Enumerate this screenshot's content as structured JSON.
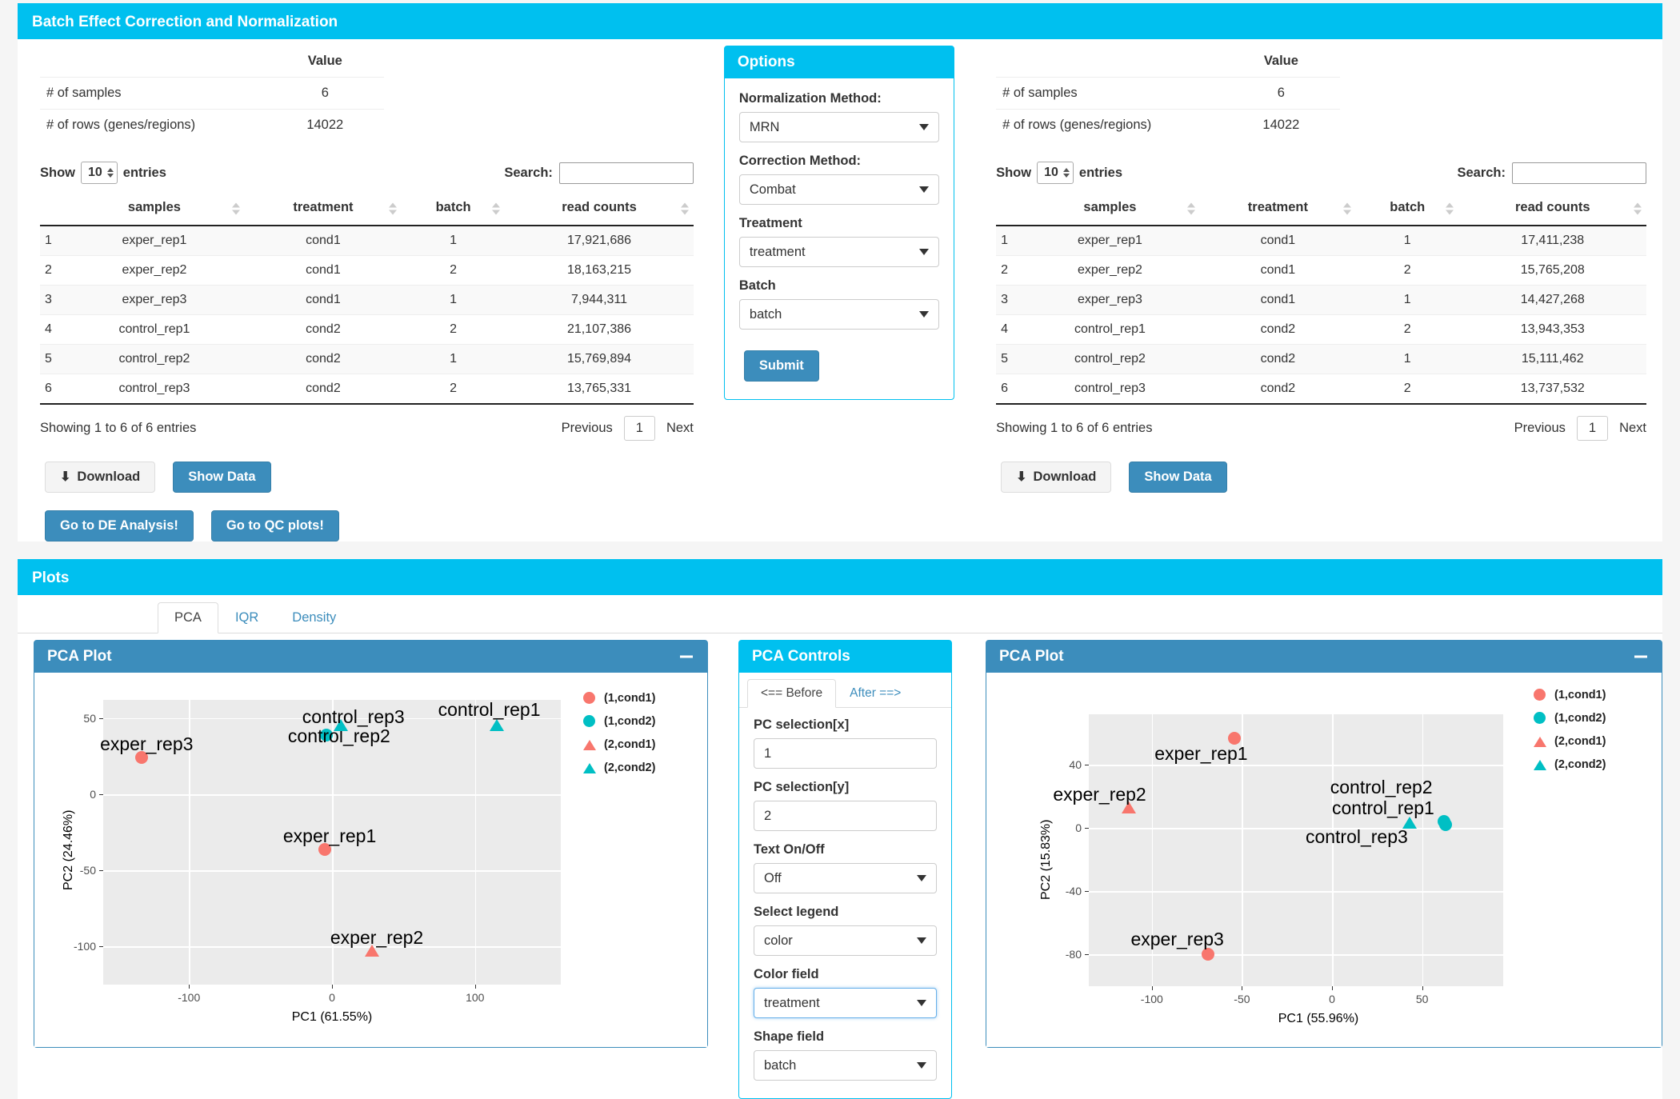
{
  "top_panel": {
    "title": "Batch Effect Correction and Normalization"
  },
  "summary": {
    "value_header": "Value",
    "rows": [
      {
        "label": "# of samples",
        "value": "6"
      },
      {
        "label": "# of rows (genes/regions)",
        "value": "14022"
      }
    ]
  },
  "datatable_controls": {
    "show_label": "Show",
    "entries_label": "entries",
    "page_length": "10",
    "search_label": "Search:",
    "search_value": "",
    "search_placeholder": ""
  },
  "table_left": {
    "columns": [
      "",
      "samples",
      "treatment",
      "batch",
      "read counts"
    ],
    "rows": [
      [
        "1",
        "exper_rep1",
        "cond1",
        "1",
        "17,921,686"
      ],
      [
        "2",
        "exper_rep2",
        "cond1",
        "2",
        "18,163,215"
      ],
      [
        "3",
        "exper_rep3",
        "cond1",
        "1",
        "7,944,311"
      ],
      [
        "4",
        "control_rep1",
        "cond2",
        "2",
        "21,107,386"
      ],
      [
        "5",
        "control_rep2",
        "cond2",
        "1",
        "15,769,894"
      ],
      [
        "6",
        "control_rep3",
        "cond2",
        "2",
        "13,765,331"
      ]
    ],
    "info": "Showing 1 to 6 of 6 entries",
    "previous": "Previous",
    "page": "1",
    "next": "Next"
  },
  "table_right": {
    "columns": [
      "",
      "samples",
      "treatment",
      "batch",
      "read counts"
    ],
    "rows": [
      [
        "1",
        "exper_rep1",
        "cond1",
        "1",
        "17,411,238"
      ],
      [
        "2",
        "exper_rep2",
        "cond1",
        "2",
        "15,765,208"
      ],
      [
        "3",
        "exper_rep3",
        "cond1",
        "1",
        "14,427,268"
      ],
      [
        "4",
        "control_rep1",
        "cond2",
        "2",
        "13,943,353"
      ],
      [
        "5",
        "control_rep2",
        "cond2",
        "1",
        "15,111,462"
      ],
      [
        "6",
        "control_rep3",
        "cond2",
        "2",
        "13,737,532"
      ]
    ],
    "info": "Showing 1 to 6 of 6 entries",
    "previous": "Previous",
    "page": "1",
    "next": "Next"
  },
  "buttons_left": {
    "download": "Download",
    "show_data": "Show Data",
    "de_analysis": "Go to DE Analysis!",
    "qc_plots": "Go to QC plots!"
  },
  "buttons_right": {
    "download": "Download",
    "show_data": "Show Data"
  },
  "options": {
    "title": "Options",
    "normalization_label": "Normalization Method:",
    "normalization_value": "MRN",
    "correction_label": "Correction Method:",
    "correction_value": "Combat",
    "treatment_label": "Treatment",
    "treatment_value": "treatment",
    "batch_label": "Batch",
    "batch_value": "batch",
    "submit": "Submit"
  },
  "plots": {
    "title": "Plots",
    "tabs": [
      {
        "label": "PCA",
        "active": true
      },
      {
        "label": "IQR",
        "active": false
      },
      {
        "label": "Density",
        "active": false
      }
    ]
  },
  "pca_controls": {
    "title": "PCA Controls",
    "tab_before": "<== Before",
    "tab_after": "After ==>",
    "pc_x_label": "PC selection[x]",
    "pc_x_value": "1",
    "pc_y_label": "PC selection[y]",
    "pc_y_value": "2",
    "text_label": "Text On/Off",
    "text_value": "Off",
    "legend_label": "Select legend",
    "legend_value": "color",
    "color_label": "Color field",
    "color_value": "treatment",
    "shape_label": "Shape field",
    "shape_value": "batch"
  },
  "colors": {
    "accent": "#00c0ef",
    "primary": "#3c8dbc",
    "cond1": "#f8766d",
    "cond2": "#00bfc4",
    "panel_bg": "#ebebeb"
  },
  "chart_data": [
    {
      "id": "pca-before",
      "type": "scatter",
      "title": "PCA Plot",
      "xlabel": "PC1 (61.55%)",
      "ylabel": "PC2 (24.46%)",
      "xlim": [
        -160,
        160
      ],
      "ylim": [
        -125,
        62
      ],
      "xticks": [
        -100,
        0,
        100
      ],
      "yticks": [
        -100,
        -50,
        0,
        50
      ],
      "grid": true,
      "legend_position": "right",
      "legend": [
        {
          "label": "(1,cond1)",
          "color": "#f8766d",
          "shape": "circle"
        },
        {
          "label": "(1,cond2)",
          "color": "#00bfc4",
          "shape": "circle"
        },
        {
          "label": "(2,cond1)",
          "color": "#f8766d",
          "shape": "triangle"
        },
        {
          "label": "(2,cond2)",
          "color": "#00bfc4",
          "shape": "triangle"
        }
      ],
      "points": [
        {
          "label": "exper_rep3",
          "x": -133,
          "y": 24,
          "color": "#f8766d",
          "shape": "circle",
          "label_dx": 6,
          "label_dy": -30
        },
        {
          "label": "exper_rep1",
          "x": -5,
          "y": -36,
          "color": "#f8766d",
          "shape": "circle",
          "label_dx": 6,
          "label_dy": -30
        },
        {
          "label": "exper_rep2",
          "x": 28,
          "y": -103,
          "color": "#f8766d",
          "shape": "triangle",
          "label_dx": 6,
          "label_dy": -30
        },
        {
          "label": "control_rep2",
          "x": -4,
          "y": 39,
          "color": "#00bfc4",
          "shape": "circle",
          "label_dx": 16,
          "label_dy": -12
        },
        {
          "label": "control_rep3",
          "x": 6,
          "y": 45,
          "color": "#00bfc4",
          "shape": "triangle",
          "label_dx": 16,
          "label_dy": -24
        },
        {
          "label": "control_rep1",
          "x": 115,
          "y": 45,
          "color": "#00bfc4",
          "shape": "triangle",
          "label_dx": -9,
          "label_dy": -33
        }
      ]
    },
    {
      "id": "pca-after",
      "type": "scatter",
      "title": "PCA Plot",
      "xlabel": "PC1 (55.96%)",
      "ylabel": "PC2 (15.83%)",
      "xlim": [
        -135,
        95
      ],
      "ylim": [
        -100,
        72
      ],
      "xticks": [
        -100,
        -50,
        0,
        50
      ],
      "yticks": [
        -80,
        -40,
        0,
        40
      ],
      "grid": true,
      "legend_position": "right",
      "legend": [
        {
          "label": "(1,cond1)",
          "color": "#f8766d",
          "shape": "circle"
        },
        {
          "label": "(1,cond2)",
          "color": "#00bfc4",
          "shape": "circle"
        },
        {
          "label": "(2,cond1)",
          "color": "#f8766d",
          "shape": "triangle"
        },
        {
          "label": "(2,cond2)",
          "color": "#00bfc4",
          "shape": "triangle"
        }
      ],
      "points": [
        {
          "label": "exper_rep1",
          "x": -54,
          "y": 57,
          "color": "#f8766d",
          "shape": "circle",
          "label_dx": -42,
          "label_dy": 6
        },
        {
          "label": "exper_rep2",
          "x": -113,
          "y": 13,
          "color": "#f8766d",
          "shape": "triangle",
          "label_dx": -36,
          "label_dy": -30
        },
        {
          "label": "exper_rep3",
          "x": -69,
          "y": -80,
          "color": "#f8766d",
          "shape": "circle",
          "label_dx": -38,
          "label_dy": -32
        },
        {
          "label": "control_rep2",
          "x": 62,
          "y": 4,
          "color": "#00bfc4",
          "shape": "circle",
          "label_dx": -78,
          "label_dy": -56
        },
        {
          "label": "control_rep1",
          "x": 63,
          "y": 2,
          "color": "#00bfc4",
          "shape": "circle",
          "label_dx": -78,
          "label_dy": -34
        },
        {
          "label": "control_rep3",
          "x": 43,
          "y": 3,
          "color": "#00bfc4",
          "shape": "triangle",
          "label_dx": -66,
          "label_dy": 4
        }
      ]
    }
  ]
}
